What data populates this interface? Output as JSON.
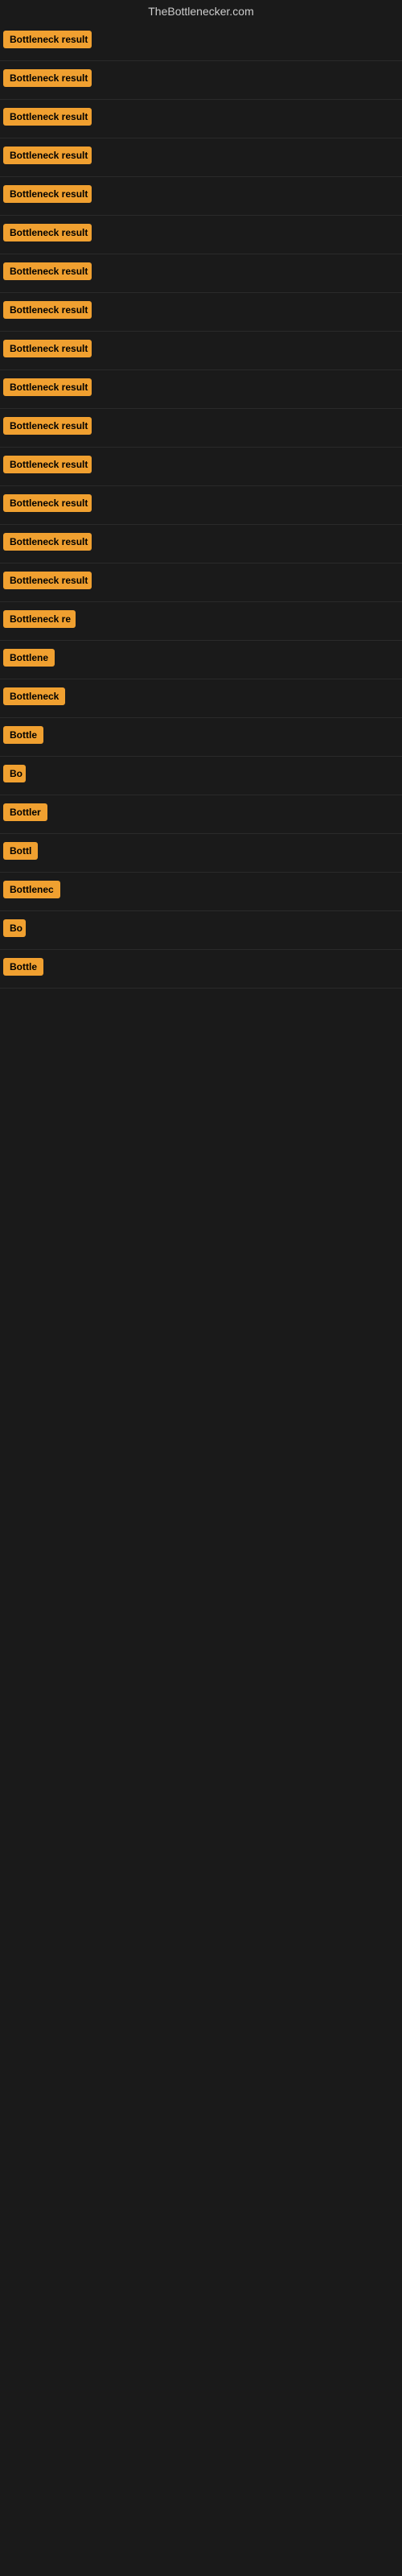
{
  "site": {
    "title": "TheBottlenecker.com"
  },
  "badges": [
    {
      "label": "Bottleneck result",
      "width": 110
    },
    {
      "label": "Bottleneck result",
      "width": 110
    },
    {
      "label": "Bottleneck result",
      "width": 110
    },
    {
      "label": "Bottleneck result",
      "width": 110
    },
    {
      "label": "Bottleneck result",
      "width": 110
    },
    {
      "label": "Bottleneck result",
      "width": 110
    },
    {
      "label": "Bottleneck result",
      "width": 110
    },
    {
      "label": "Bottleneck result",
      "width": 110
    },
    {
      "label": "Bottleneck result",
      "width": 110
    },
    {
      "label": "Bottleneck result",
      "width": 110
    },
    {
      "label": "Bottleneck result",
      "width": 110
    },
    {
      "label": "Bottleneck result",
      "width": 110
    },
    {
      "label": "Bottleneck result",
      "width": 110
    },
    {
      "label": "Bottleneck result",
      "width": 110
    },
    {
      "label": "Bottleneck result",
      "width": 110
    },
    {
      "label": "Bottleneck re",
      "width": 90
    },
    {
      "label": "Bottlene",
      "width": 72
    },
    {
      "label": "Bottleneck",
      "width": 78
    },
    {
      "label": "Bottle",
      "width": 58
    },
    {
      "label": "Bo",
      "width": 28
    },
    {
      "label": "Bottler",
      "width": 62
    },
    {
      "label": "Bottl",
      "width": 50
    },
    {
      "label": "Bottlenec",
      "width": 75
    },
    {
      "label": "Bo",
      "width": 28
    },
    {
      "label": "Bottle",
      "width": 58
    }
  ]
}
